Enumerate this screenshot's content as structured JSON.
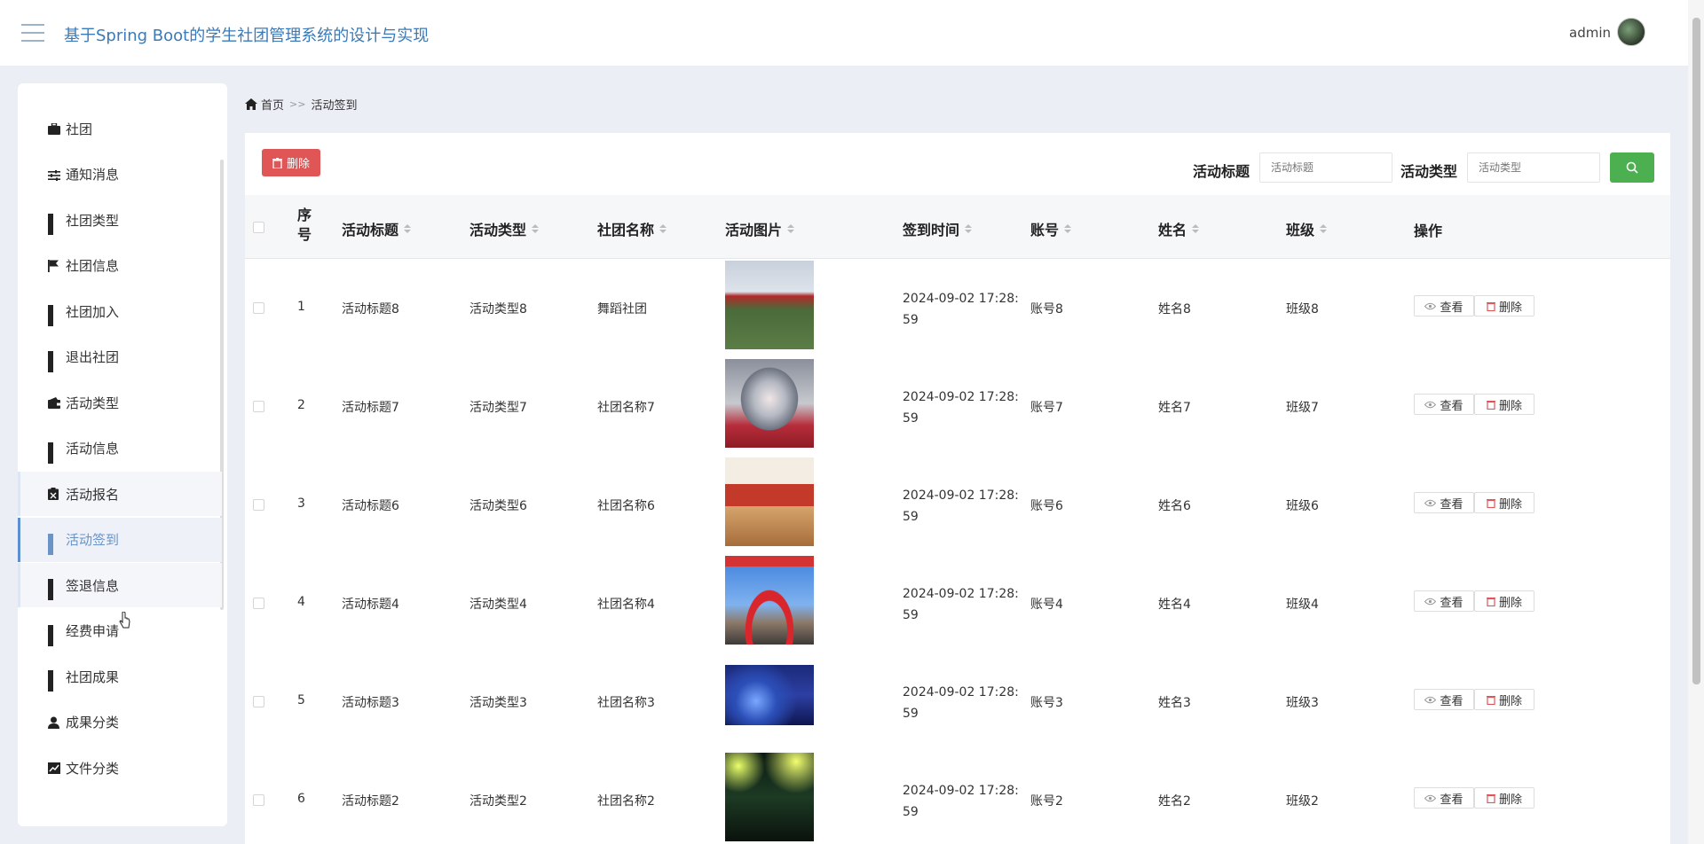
{
  "header": {
    "title": "基于Spring Boot的学生社团管理系统的设计与实现",
    "user": "admin"
  },
  "sidebar": {
    "items": [
      {
        "label": "社团",
        "icon": "briefcase-icon"
      },
      {
        "label": "通知消息",
        "icon": "sliders-icon"
      },
      {
        "label": "社团类型",
        "icon": "grid-icon"
      },
      {
        "label": "社团信息",
        "icon": "flag-icon"
      },
      {
        "label": "社团加入",
        "icon": "grid-icon"
      },
      {
        "label": "退出社团",
        "icon": "grid-icon"
      },
      {
        "label": "活动类型",
        "icon": "wallet-icon"
      },
      {
        "label": "活动信息",
        "icon": "grid-icon"
      },
      {
        "label": "活动报名",
        "icon": "clipboard-icon"
      },
      {
        "label": "活动签到",
        "icon": "grid-icon",
        "active": true
      },
      {
        "label": "签退信息",
        "icon": "grid-icon"
      },
      {
        "label": "经费申请",
        "icon": "grid-icon"
      },
      {
        "label": "社团成果",
        "icon": "grid-icon"
      },
      {
        "label": "成果分类",
        "icon": "user-icon"
      },
      {
        "label": "文件分类",
        "icon": "chart-icon"
      }
    ]
  },
  "breadcrumb": {
    "home": "首页",
    "sep": ">>",
    "current": "活动签到"
  },
  "toolbar": {
    "delete_label": "删除",
    "filter1_label": "活动标题",
    "filter1_placeholder": "活动标题",
    "filter2_label": "活动类型",
    "filter2_placeholder": "活动类型"
  },
  "table": {
    "headers": {
      "index": "序号",
      "title": "活动标题",
      "type": "活动类型",
      "club": "社团名称",
      "image": "活动图片",
      "time": "签到时间",
      "account": "账号",
      "name": "姓名",
      "class": "班级",
      "action": "操作"
    },
    "view_label": "查看",
    "delete_label": "删除",
    "rows": [
      {
        "index": "1",
        "title": "活动标题8",
        "type": "活动类型8",
        "club": "舞蹈社团",
        "time1": "2024-09-02 17:28:",
        "time2": "59",
        "account": "账号8",
        "name": "姓名8",
        "class": "班级8"
      },
      {
        "index": "2",
        "title": "活动标题7",
        "type": "活动类型7",
        "club": "社团名称7",
        "time1": "2024-09-02 17:28:",
        "time2": "59",
        "account": "账号7",
        "name": "姓名7",
        "class": "班级7"
      },
      {
        "index": "3",
        "title": "活动标题6",
        "type": "活动类型6",
        "club": "社团名称6",
        "time1": "2024-09-02 17:28:",
        "time2": "59",
        "account": "账号6",
        "name": "姓名6",
        "class": "班级6"
      },
      {
        "index": "4",
        "title": "活动标题4",
        "type": "活动类型4",
        "club": "社团名称4",
        "time1": "2024-09-02 17:28:",
        "time2": "59",
        "account": "账号4",
        "name": "姓名4",
        "class": "班级4"
      },
      {
        "index": "5",
        "title": "活动标题3",
        "type": "活动类型3",
        "club": "社团名称3",
        "time1": "2024-09-02 17:28:",
        "time2": "59",
        "account": "账号3",
        "name": "姓名3",
        "class": "班级3"
      },
      {
        "index": "6",
        "title": "活动标题2",
        "type": "活动类型2",
        "club": "社团名称2",
        "time1": "2024-09-02 17:28:",
        "time2": "59",
        "account": "账号2",
        "name": "姓名2",
        "class": "班级2"
      }
    ]
  },
  "colors": {
    "accent": "#3a7ab8",
    "danger": "#e05555",
    "success": "#4caf50",
    "active": "#6a93c8"
  }
}
